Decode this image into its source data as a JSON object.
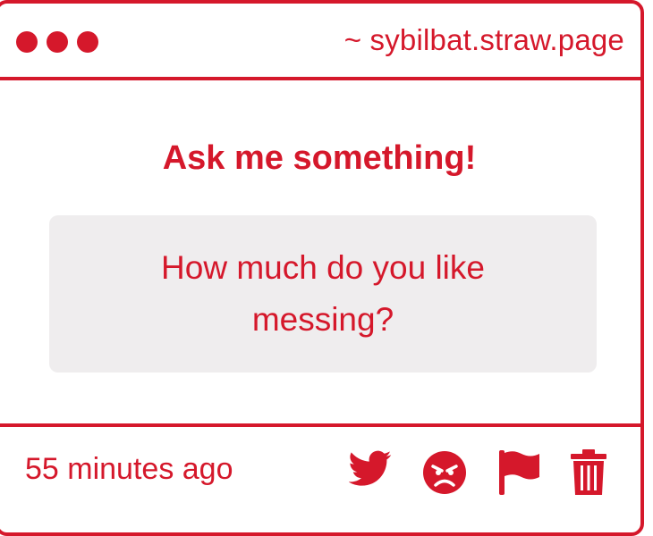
{
  "header": {
    "site": "~ sybilbat.straw.page",
    "window_dots": [
      "dot",
      "dot",
      "dot"
    ]
  },
  "main": {
    "heading": "Ask me something!",
    "question": "How much do you like messing?"
  },
  "footer": {
    "timestamp": "55 minutes ago",
    "actions": [
      {
        "name": "share-twitter",
        "icon": "twitter-bird-icon"
      },
      {
        "name": "react-angry",
        "icon": "angry-face-icon"
      },
      {
        "name": "report",
        "icon": "flag-icon"
      },
      {
        "name": "delete",
        "icon": "trash-icon"
      }
    ]
  },
  "colors": {
    "accent": "#d5182b",
    "box_background": "#efedee",
    "background": "#ffffff"
  }
}
